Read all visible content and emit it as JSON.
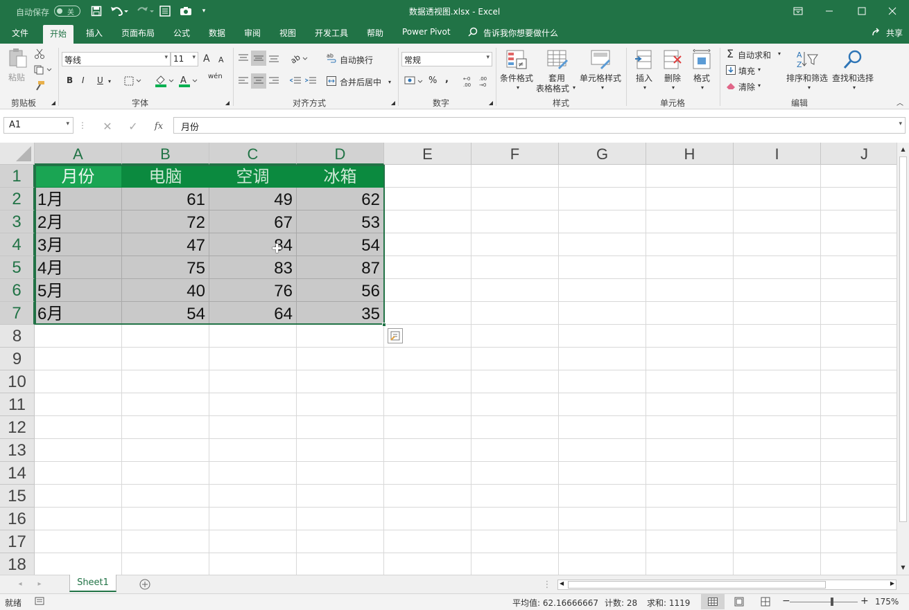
{
  "titlebar": {
    "autosave_label": "自动保存",
    "autosave_state": "关",
    "title": "数据透视图.xlsx  -  Excel"
  },
  "tabs": [
    "文件",
    "开始",
    "插入",
    "页面布局",
    "公式",
    "数据",
    "审阅",
    "视图",
    "开发工具",
    "帮助",
    "Power Pivot"
  ],
  "active_tab": "开始",
  "tellme": "告诉我你想要做什么",
  "share": "共享",
  "ribbon": {
    "clipboard": {
      "paste": "粘贴",
      "group": "剪贴板"
    },
    "font": {
      "name": "等线",
      "size": "11",
      "group": "字体",
      "bold": "B",
      "italic": "I",
      "underline": "U",
      "grow": "A",
      "shrink": "A",
      "phonetic": "wén"
    },
    "alignment": {
      "wrap": "自动换行",
      "merge": "合并后居中",
      "group": "对齐方式"
    },
    "number": {
      "format": "常规",
      "percent": "%",
      "comma": ",",
      "group": "数字"
    },
    "styles": {
      "conditional": "条件格式",
      "table1": "套用",
      "table2": "表格格式",
      "cell_styles": "单元格样式",
      "group": "样式"
    },
    "cells": {
      "insert": "插入",
      "delete": "删除",
      "format": "格式",
      "group": "单元格"
    },
    "editing": {
      "autosum": "自动求和",
      "fill": "填充",
      "clear": "清除",
      "sort": "排序和筛选",
      "find": "查找和选择",
      "group": "编辑"
    }
  },
  "formula_bar": {
    "name_box": "A1",
    "fx": "fx",
    "value": "月份"
  },
  "columns": [
    "A",
    "B",
    "C",
    "D",
    "E",
    "F",
    "G",
    "H",
    "I",
    "J"
  ],
  "rows": [
    "1",
    "2",
    "3",
    "4",
    "5",
    "6",
    "7",
    "8",
    "9",
    "10",
    "11",
    "12",
    "13",
    "14",
    "15",
    "16",
    "17",
    "18"
  ],
  "table": {
    "headers": [
      "月份",
      "电脑",
      "空调",
      "冰箱"
    ],
    "rows": [
      [
        "1月",
        "61",
        "49",
        "62"
      ],
      [
        "2月",
        "72",
        "67",
        "53"
      ],
      [
        "3月",
        "47",
        "84",
        "54"
      ],
      [
        "4月",
        "75",
        "83",
        "87"
      ],
      [
        "5月",
        "40",
        "76",
        "56"
      ],
      [
        "6月",
        "54",
        "64",
        "35"
      ]
    ]
  },
  "sheets": [
    "Sheet1"
  ],
  "status": {
    "ready": "就绪",
    "average": "平均值: 62.16666667",
    "count": "计数: 28",
    "sum": "求和: 1119",
    "zoom": "175%"
  },
  "colors": {
    "brand": "#217346",
    "header_fill": "#0b8a3f",
    "selection_fill": "#c9c9c9"
  }
}
